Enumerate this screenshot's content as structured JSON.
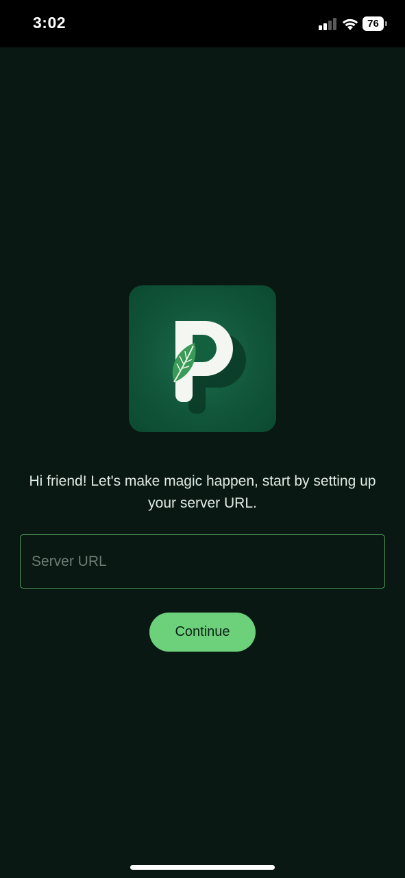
{
  "status_bar": {
    "time": "3:02",
    "battery_level": "76",
    "icons": [
      "cellular-signal-icon",
      "wifi-icon",
      "battery-icon"
    ]
  },
  "logo": {
    "icon": "leaf-letter-p-logo",
    "letter": "P"
  },
  "welcome": {
    "message": "Hi friend! Let's make magic happen, start by setting up your server URL."
  },
  "server_url": {
    "placeholder": "Server URL",
    "value": ""
  },
  "continue_button": {
    "label": "Continue"
  },
  "colors": {
    "background": "#091812",
    "accent": "#6cd17a",
    "logo_bg": "#11553a",
    "field_border": "#4d9c5e"
  }
}
